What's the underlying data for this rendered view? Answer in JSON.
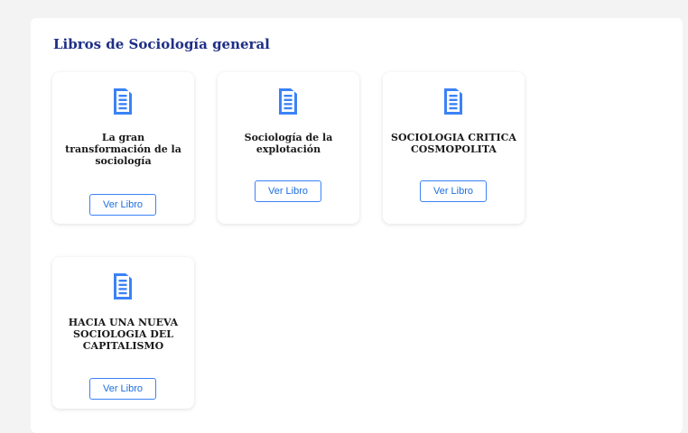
{
  "section": {
    "title": "Libros de Sociología general"
  },
  "books": [
    {
      "title": "La gran transformación de la sociología",
      "button_label": "Ver Libro",
      "icon": "book-icon"
    },
    {
      "title": "Sociología de la explotación",
      "button_label": "Ver Libro",
      "icon": "book-icon"
    },
    {
      "title": "SOCIOLOGIA CRITICA COSMOPOLITA",
      "button_label": "Ver Libro",
      "icon": "book-icon"
    },
    {
      "title": "HACIA UNA NUEVA SOCIOLOGIA DEL CAPITALISMO",
      "button_label": "Ver Libro",
      "icon": "book-icon"
    }
  ],
  "colors": {
    "title": "#1f2f86",
    "icon": "#3b82f6",
    "button_border": "#3b82f6",
    "button_text": "#1e6fe0"
  }
}
